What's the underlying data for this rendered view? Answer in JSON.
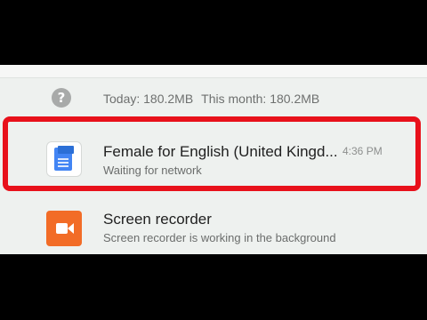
{
  "usage": {
    "today": "Today: 180.2MB",
    "month": "This month: 180.2MB",
    "icon": "help-icon",
    "icon_glyph": "?"
  },
  "notifications": [
    {
      "title": "Female for English (United Kingd...",
      "subtitle": "Waiting for network",
      "time": "4:36 PM",
      "icon": "document-icon",
      "icon_tag": "෴ d"
    },
    {
      "title": "Screen recorder",
      "subtitle": "Screen recorder is working in the background",
      "icon": "video-camera-icon"
    }
  ],
  "colors": {
    "highlight": "#e8111b",
    "recorder_icon": "#f26c27",
    "doc_icon": "#4285f4",
    "background": "#eef1ef"
  }
}
